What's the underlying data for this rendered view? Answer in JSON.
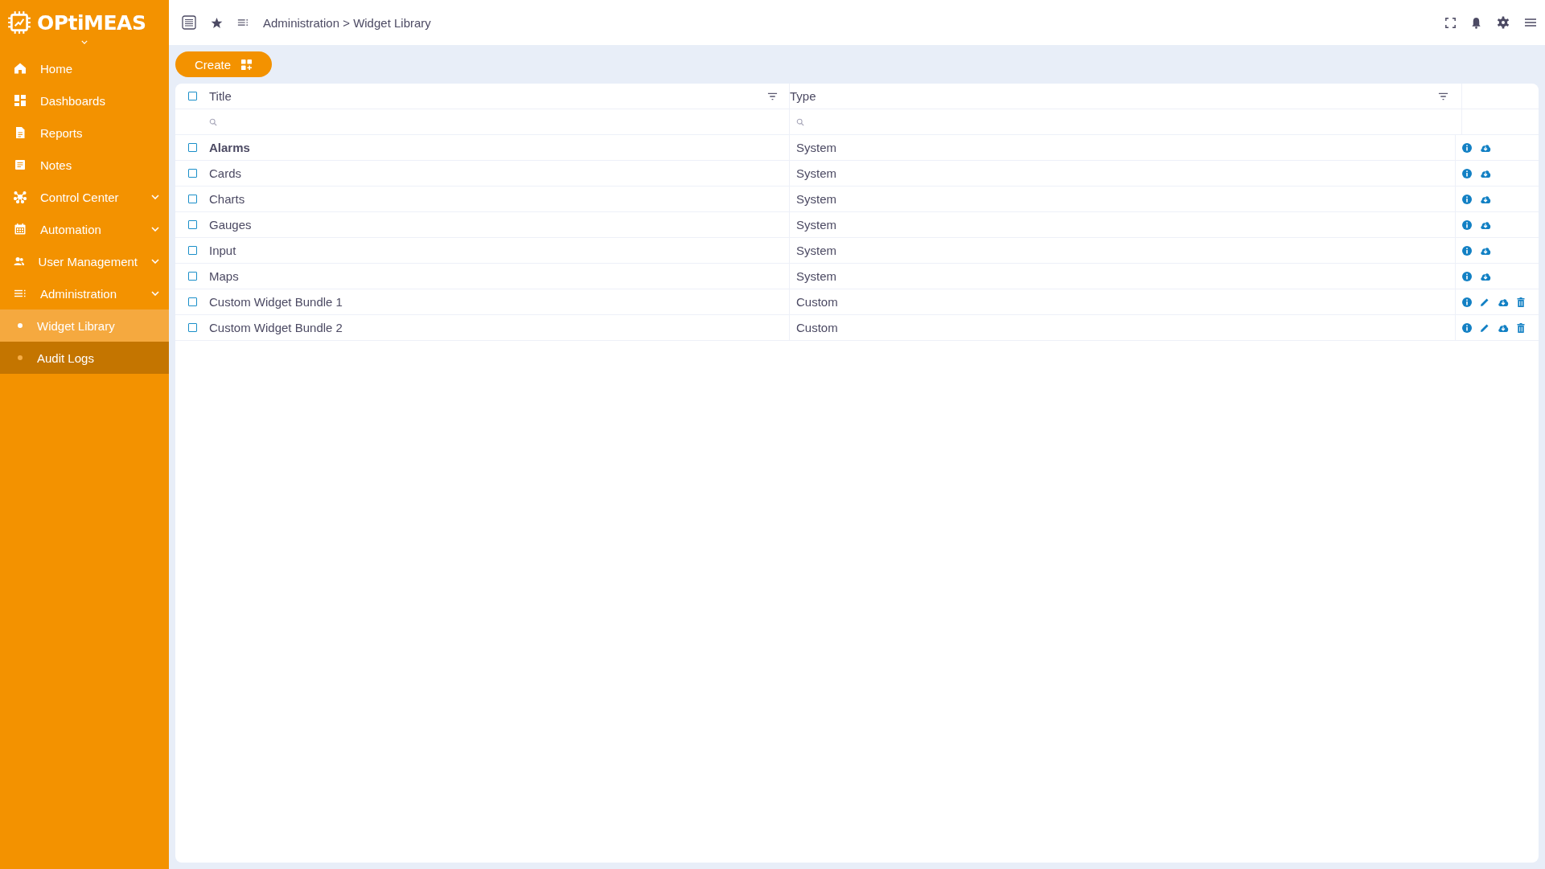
{
  "logo": {
    "text": "OPtiMEAS"
  },
  "sidebar": {
    "items": [
      {
        "label": "Home",
        "expandable": false
      },
      {
        "label": "Dashboards",
        "expandable": false
      },
      {
        "label": "Reports",
        "expandable": false
      },
      {
        "label": "Notes",
        "expandable": false
      },
      {
        "label": "Control Center",
        "expandable": true
      },
      {
        "label": "Automation",
        "expandable": true
      },
      {
        "label": "User Management",
        "expandable": true
      },
      {
        "label": "Administration",
        "expandable": true,
        "children": [
          {
            "label": "Widget Library",
            "selected": true
          },
          {
            "label": "Audit Logs",
            "selected": false
          }
        ]
      }
    ]
  },
  "topbar": {
    "breadcrumb": "Administration > Widget Library"
  },
  "toolbar": {
    "create_button": "Create"
  },
  "table": {
    "select_all_checked": false,
    "columns": [
      {
        "label": "Title"
      },
      {
        "label": "Type"
      }
    ],
    "rows": [
      {
        "title": "Alarms",
        "type": "System",
        "bold": true,
        "checked": false,
        "editable": false,
        "deletable": false
      },
      {
        "title": "Cards",
        "type": "System",
        "bold": false,
        "checked": false,
        "editable": false,
        "deletable": false
      },
      {
        "title": "Charts",
        "type": "System",
        "bold": false,
        "checked": false,
        "editable": false,
        "deletable": false
      },
      {
        "title": "Gauges",
        "type": "System",
        "bold": false,
        "checked": false,
        "editable": false,
        "deletable": false
      },
      {
        "title": "Input",
        "type": "System",
        "bold": false,
        "checked": false,
        "editable": false,
        "deletable": false
      },
      {
        "title": "Maps",
        "type": "System",
        "bold": false,
        "checked": false,
        "editable": false,
        "deletable": false
      },
      {
        "title": "Custom Widget Bundle 1",
        "type": "Custom",
        "bold": false,
        "checked": false,
        "editable": true,
        "deletable": true
      },
      {
        "title": "Custom Widget Bundle 2",
        "type": "Custom",
        "bold": false,
        "checked": false,
        "editable": true,
        "deletable": true
      }
    ]
  }
}
